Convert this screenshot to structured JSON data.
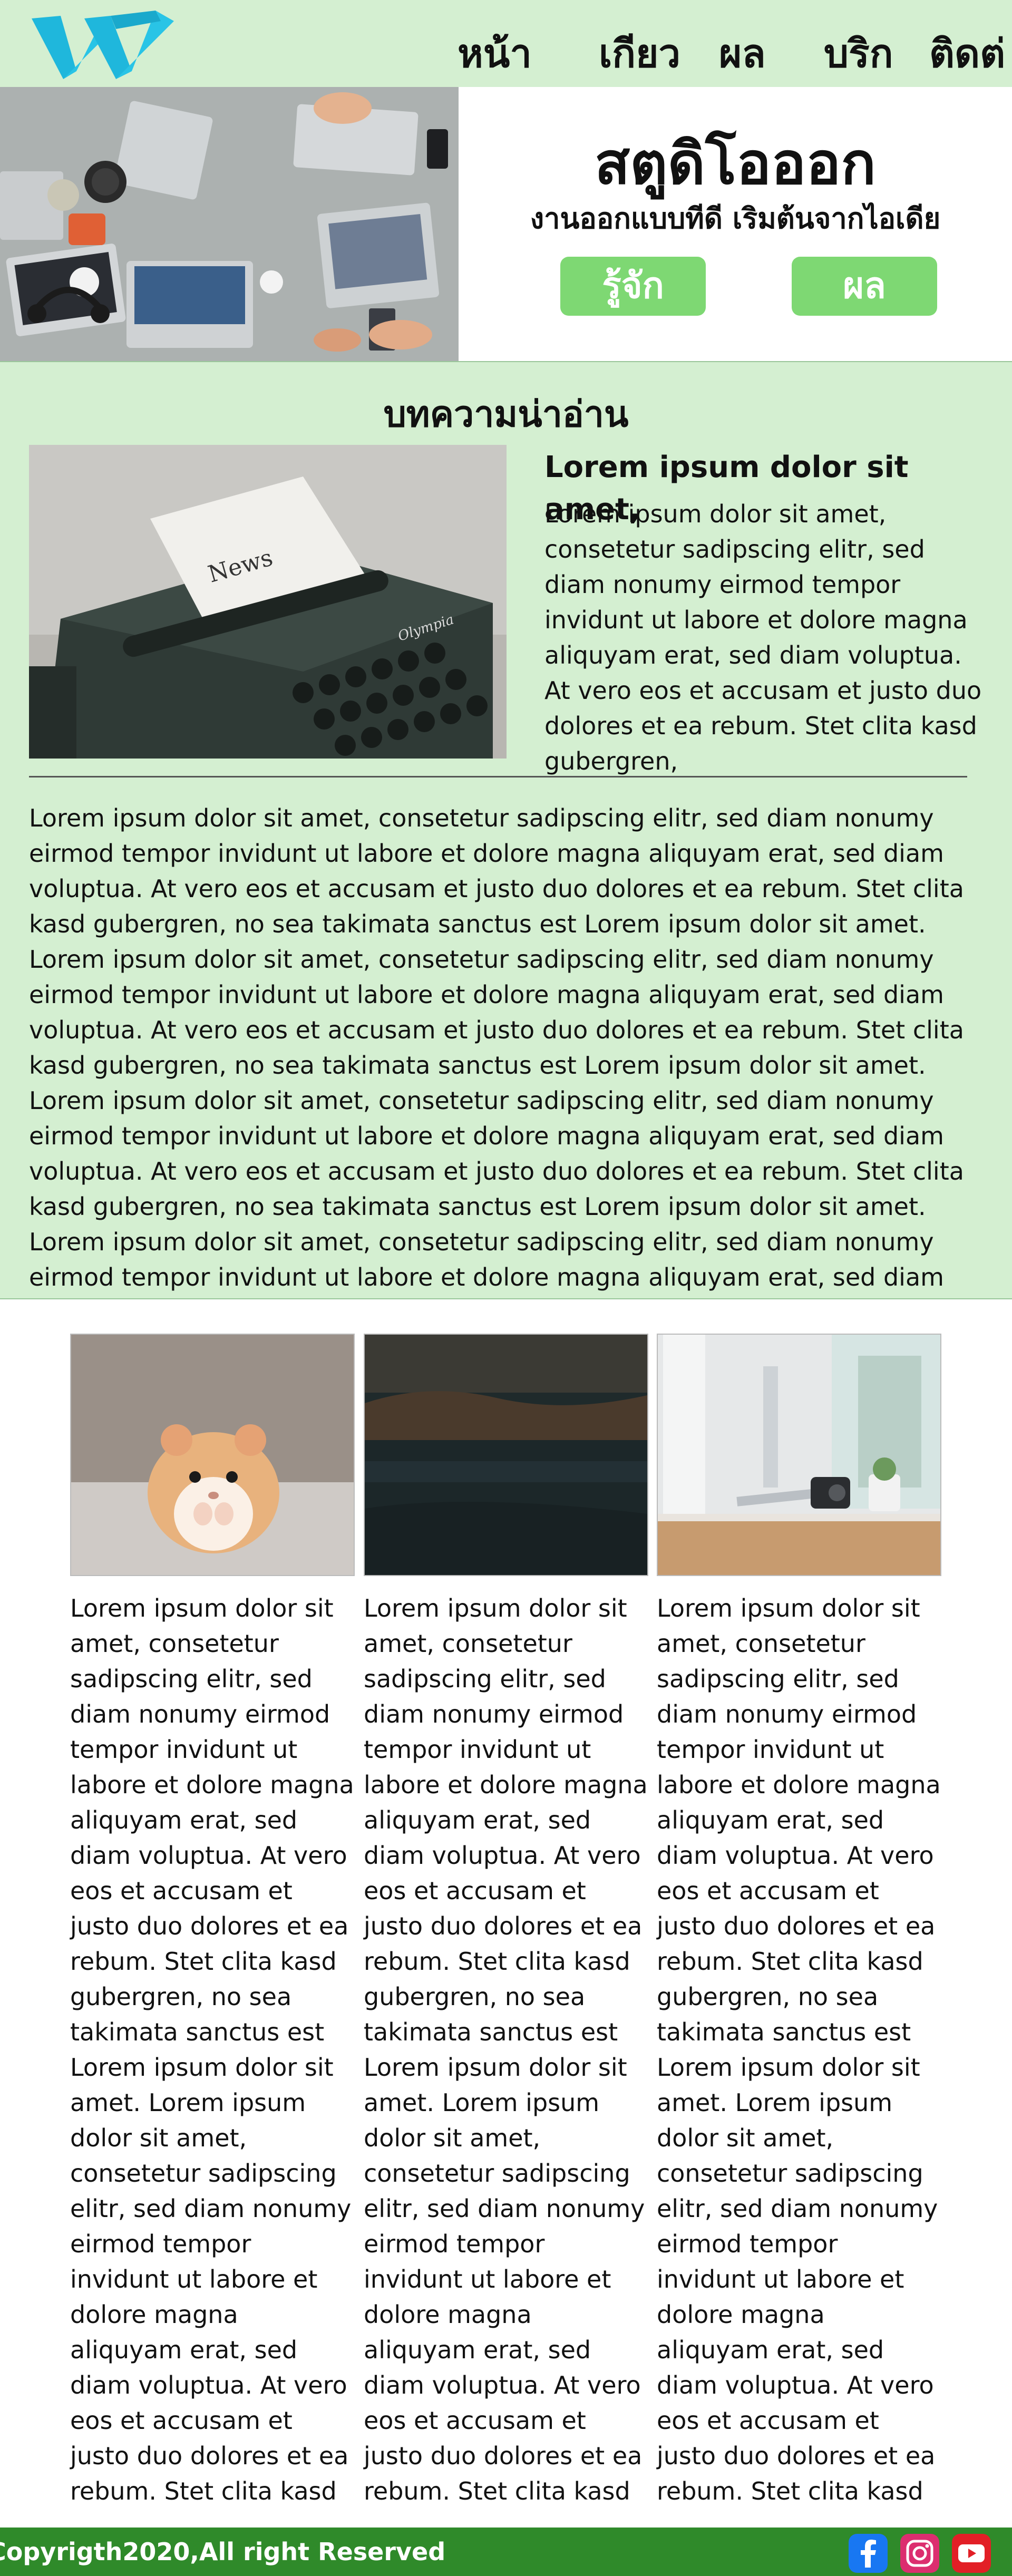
{
  "nav": {
    "logo_letter": "W",
    "links": [
      "หน้า",
      "เกียว",
      "ผล",
      "บริก",
      "ติดต่"
    ]
  },
  "hero": {
    "title": "สตูดิโอออก",
    "subtitle": "งานออกแบบทีดี เริมต้นจากไอเดีย",
    "button_primary": "รู้จัก",
    "button_secondary": "ผล"
  },
  "articles": {
    "heading": "บทความน่าอ่าน",
    "featured_title": "Lorem ipsum dolor sit amet,",
    "featured_text": "Lorem ipsum dolor sit amet, consetetur sadipscing elitr, sed diam nonumy eirmod tempor invidunt ut labore et dolore magna aliquyam erat, sed diam voluptua. At vero eos et accusam et justo duo dolores et ea rebum. Stet clita kasd gubergren,",
    "featured_image_text": "News",
    "featured_image_brand": "Olympia",
    "paragraph_1": "Lorem ipsum dolor sit amet, consetetur sadipscing elitr, sed diam nonumy eirmod tempor invidunt ut labore et dolore magna aliquyam erat, sed diam voluptua. At vero eos et accusam et justo duo dolores et ea rebum. Stet clita kasd gubergren, no sea takimata sanctus est Lorem ipsum dolor sit amet. Lorem ipsum dolor sit amet, consetetur sadipscing elitr, sed diam nonumy eirmod tempor invidunt ut labore et dolore magna aliquyam erat, sed diam voluptua. At vero eos et accusam et justo duo dolores et ea rebum. Stet clita kasd gubergren, no sea takimata sanctus est Lorem ipsum dolor sit amet.",
    "paragraph_2": "Lorem ipsum dolor sit amet, consetetur sadipscing elitr, sed diam nonumy eirmod tempor invidunt ut labore et dolore magna aliquyam erat, sed diam voluptua. At vero eos et accusam et justo duo dolores et ea rebum. Stet clita kasd gubergren, no sea takimata sanctus est Lorem ipsum dolor sit amet. Lorem ipsum dolor sit amet, consetetur sadipscing elitr, sed diam nonumy eirmod tempor invidunt ut labore et dolore magna aliquyam erat, sed diam voluptua. At"
  },
  "cards": [
    {
      "text": "Lorem ipsum dolor sit amet, consetetur sadipscing elitr, sed diam nonumy eirmod tempor invidunt ut labore et dolore magna aliquyam erat, sed diam voluptua. At vero eos et accusam et justo duo dolores et ea rebum. Stet clita kasd gubergren, no sea takimata sanctus est Lorem ipsum dolor sit amet. Lorem ipsum dolor sit amet, consetetur sadipscing elitr, sed diam nonumy eirmod tempor invidunt ut labore et dolore magna aliquyam erat, sed diam voluptua. At vero eos et accusam et justo duo dolores et ea rebum. Stet clita kasd"
    },
    {
      "text": "Lorem ipsum dolor sit amet, consetetur sadipscing elitr, sed diam nonumy eirmod tempor invidunt ut labore et dolore magna aliquyam erat, sed diam voluptua. At vero eos et accusam et justo duo dolores et ea rebum. Stet clita kasd gubergren, no sea takimata sanctus est Lorem ipsum dolor sit amet. Lorem ipsum dolor sit amet, consetetur sadipscing elitr, sed diam nonumy eirmod tempor invidunt ut labore et dolore magna aliquyam erat, sed diam voluptua. At vero eos et accusam et justo duo dolores et ea rebum. Stet clita kasd"
    },
    {
      "text": "Lorem ipsum dolor sit amet, consetetur sadipscing elitr, sed diam nonumy eirmod tempor invidunt ut labore et dolore magna aliquyam erat, sed diam voluptua. At vero eos et accusam et justo duo dolores et ea rebum. Stet clita kasd gubergren, no sea takimata sanctus est Lorem ipsum dolor sit amet. Lorem ipsum dolor sit amet, consetetur sadipscing elitr, sed diam nonumy eirmod tempor invidunt ut labore et dolore magna aliquyam erat, sed diam voluptua. At vero eos et accusam et justo duo dolores et ea rebum. Stet clita kasd"
    }
  ],
  "footer": {
    "copyright": "Copyrigth2020,All right Reserved",
    "social": [
      "facebook-icon",
      "instagram-icon",
      "youtube-icon"
    ]
  },
  "colors": {
    "nav_bg": "#d4efd1",
    "section_bg": "#d4efd1",
    "button_bg": "#7ed873",
    "footer_bg": "#2f8a2a",
    "logo": "#29c4e6"
  }
}
